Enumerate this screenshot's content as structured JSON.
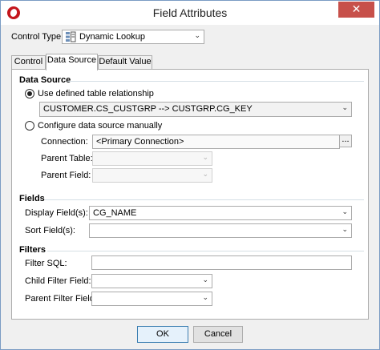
{
  "window": {
    "title": "Field Attributes",
    "close_glyph": "✕"
  },
  "control_type": {
    "label": "Control Type:",
    "value": "Dynamic Lookup",
    "icon": "lookup-icon"
  },
  "tabs": [
    {
      "label": "Control",
      "active": false
    },
    {
      "label": "Data Source",
      "active": true
    },
    {
      "label": "Default Value",
      "active": false
    }
  ],
  "data_source": {
    "section_title": "Data Source",
    "option_defined_label": "Use defined table relationship",
    "relationship_value": "CUSTOMER.CS_CUSTGRP --> CUSTGRP.CG_KEY",
    "option_manual_label": "Configure data source manually",
    "connection_label": "Connection:",
    "connection_value": "<Primary Connection>",
    "browse_label": "...",
    "parent_table_label": "Parent Table:",
    "parent_table_value": "",
    "parent_field_label": "Parent Field:",
    "parent_field_value": ""
  },
  "fields": {
    "section_title": "Fields",
    "display_label": "Display Field(s):",
    "display_value": "CG_NAME",
    "sort_label": "Sort Field(s):",
    "sort_value": ""
  },
  "filters": {
    "section_title": "Filters",
    "filter_sql_label": "Filter SQL:",
    "filter_sql_value": "",
    "child_filter_label": "Child Filter Field:",
    "child_filter_value": "",
    "parent_filter_label": "Parent Filter Field:",
    "parent_filter_value": ""
  },
  "buttons": {
    "ok": "OK",
    "cancel": "Cancel"
  },
  "dropdown_glyph": "⌄"
}
